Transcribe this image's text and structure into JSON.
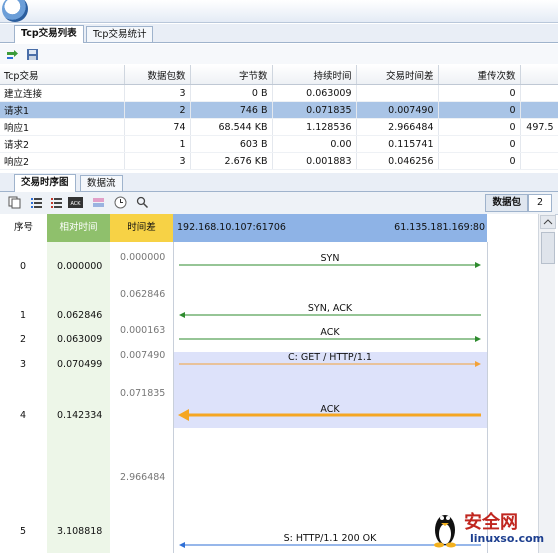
{
  "tabs_top": [
    {
      "label": "Tcp交易列表"
    },
    {
      "label": "Tcp交易统计"
    }
  ],
  "table": {
    "headers": [
      "Tcp交易",
      "数据包数",
      "字节数",
      "持续时间",
      "交易时间差",
      "重传次数"
    ],
    "rows": [
      {
        "name": "建立连接",
        "packets": "3",
        "bytes": "0  B",
        "duration": "0.063009",
        "delta": "",
        "retrans": "0",
        "extra": ""
      },
      {
        "name": "请求1",
        "packets": "2",
        "bytes": "746  B",
        "duration": "0.071835",
        "delta": "0.007490",
        "retrans": "0",
        "extra": ""
      },
      {
        "name": "响应1",
        "packets": "74",
        "bytes": "68.544 KB",
        "duration": "1.128536",
        "delta": "2.966484",
        "retrans": "0",
        "extra": "497.5"
      },
      {
        "name": "请求2",
        "packets": "1",
        "bytes": "603  B",
        "duration": "0.00",
        "delta": "0.115741",
        "retrans": "0",
        "extra": ""
      },
      {
        "name": "响应2",
        "packets": "3",
        "bytes": "2.676 KB",
        "duration": "0.001883",
        "delta": "0.046256",
        "retrans": "0",
        "extra": ""
      }
    ]
  },
  "tabs_bottom": [
    {
      "label": "交易时序图"
    },
    {
      "label": "数据流"
    }
  ],
  "packet_box": {
    "label": "数据包",
    "count": "2"
  },
  "seq": {
    "col_no": "序号",
    "col_rel": "相对时间",
    "col_delta": "时间差",
    "host_left": "192.168.10.107:61706",
    "host_right": "61.135.181.169:80",
    "events": [
      {
        "no": "0",
        "rel": "0.000000",
        "label": "SYN",
        "dir": "right",
        "color": "#2e8b2e"
      },
      {
        "no": "1",
        "rel": "0.062846",
        "label": "SYN, ACK",
        "dir": "left",
        "color": "#2e8b2e"
      },
      {
        "no": "2",
        "rel": "0.063009",
        "label": "ACK",
        "dir": "right",
        "color": "#2e8b2e"
      },
      {
        "no": "3",
        "rel": "0.070499",
        "label": "C: GET / HTTP/1.1",
        "dir": "right",
        "color": "#f2a23a"
      },
      {
        "no": "4",
        "rel": "0.142334",
        "label": "ACK",
        "dir": "left",
        "color": "#f5a623"
      },
      {
        "no": "5",
        "rel": "3.108818",
        "label": "S: HTTP/1.1 200 OK",
        "dir": "left",
        "color": "#2f6fd6"
      }
    ],
    "deltas": [
      "0.000000",
      "0.062846",
      "0.000163",
      "0.007490",
      "0.071835",
      "2.966484"
    ]
  },
  "watermark": {
    "text": "安全网",
    "url": "linuxso.com"
  }
}
